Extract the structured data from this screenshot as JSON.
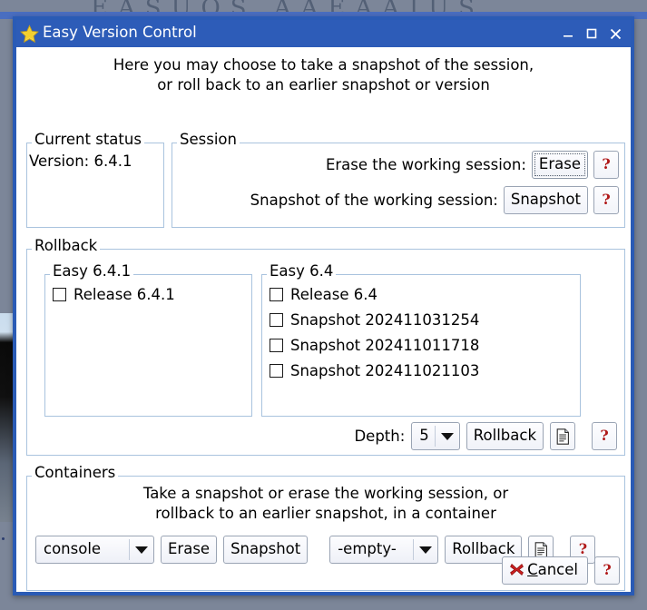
{
  "desktop": {
    "wallpaper_text": "EASUOS  AAEAAIUS"
  },
  "window": {
    "title": "Easy Version Control",
    "icon": "star-icon",
    "titlebar_color": "#2d5cb8",
    "controls": {
      "minimize": "minimize-icon",
      "maximize": "maximize-icon",
      "close": "close-icon"
    }
  },
  "intro": {
    "line1": "Here you may choose to take a snapshot of the session,",
    "line2": "or roll back to an earlier snapshot or version"
  },
  "current_status": {
    "legend": "Current status",
    "version_label": "Version: 6.4.1"
  },
  "session": {
    "legend": "Session",
    "rows": [
      {
        "label": "Erase the working session:",
        "button": "Erase",
        "focused": true,
        "help": "?"
      },
      {
        "label": "Snapshot of the working session:",
        "button": "Snapshot",
        "focused": false,
        "help": "?"
      }
    ]
  },
  "rollback": {
    "legend": "Rollback",
    "groups": [
      {
        "legend": "Easy 6.4.1",
        "items": [
          {
            "label": "Release 6.4.1",
            "checked": false
          }
        ]
      },
      {
        "legend": "Easy 6.4",
        "items": [
          {
            "label": "Release 6.4",
            "checked": false
          },
          {
            "label": "Snapshot 202411031254",
            "checked": false
          },
          {
            "label": "Snapshot 202411011718",
            "checked": false
          },
          {
            "label": "Snapshot 202411021103",
            "checked": false
          }
        ]
      }
    ],
    "depth_label": "Depth:",
    "depth_value": "5",
    "rollback_button": "Rollback",
    "doc_icon": "document-icon",
    "help": "?"
  },
  "containers": {
    "legend": "Containers",
    "description_line1": "Take a snapshot or erase the working session, or",
    "description_line2": "rollback to an earlier snapshot, in a container",
    "container_select_value": "console",
    "erase_button": "Erase",
    "snapshot_button": "Snapshot",
    "snapshot_select_value": "-empty-",
    "rollback_button": "Rollback",
    "doc_icon": "document-icon",
    "help": "?"
  },
  "footer": {
    "cancel_prefix": "C",
    "cancel_rest": "ancel",
    "cancel_icon": "red-x-icon",
    "help": "?"
  },
  "colors": {
    "title_bar": "#2d5cb8",
    "group_border": "#a9c3de",
    "help_glyph": "#b01818",
    "cancel_x": "#cf2020",
    "star": "#f5d033"
  }
}
